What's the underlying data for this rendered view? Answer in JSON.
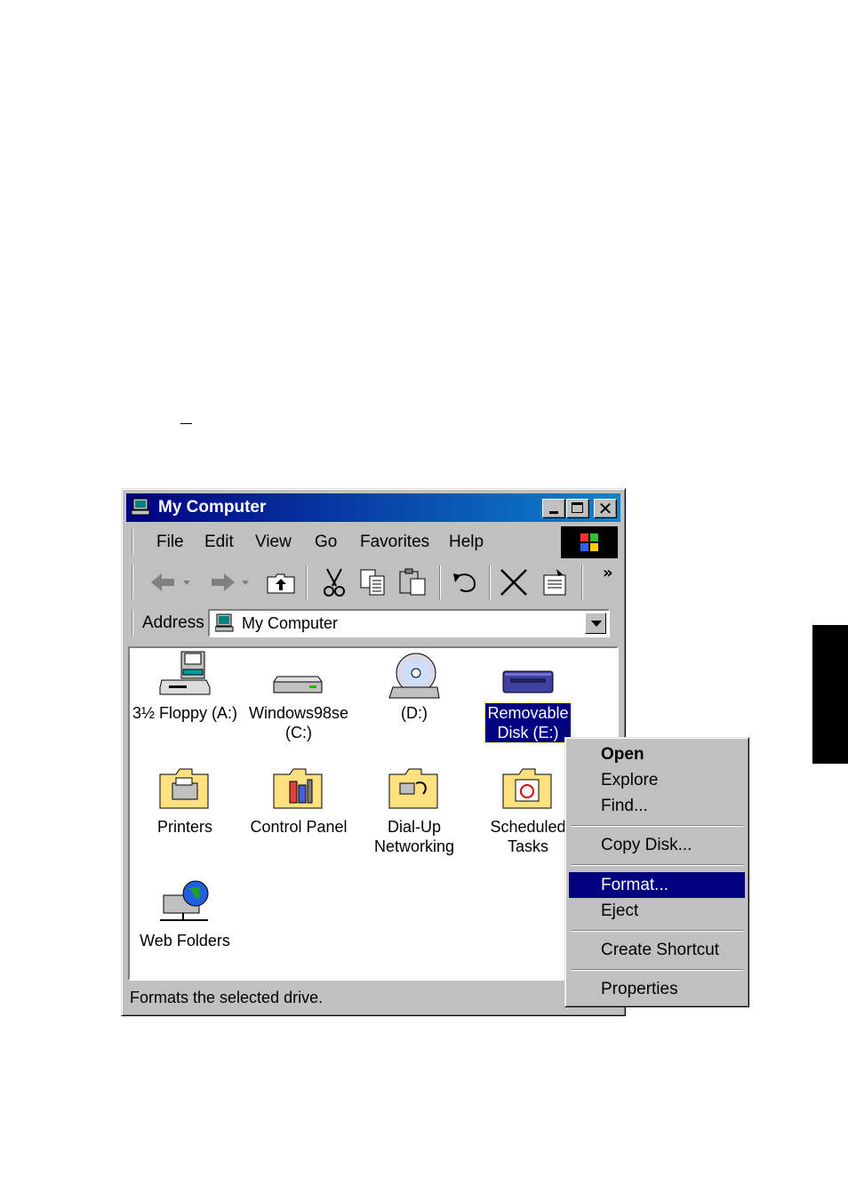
{
  "window": {
    "title": "My Computer",
    "menu": [
      "File",
      "Edit",
      "View",
      "Go",
      "Favorites",
      "Help"
    ],
    "toolbar_more": "»",
    "address": {
      "label": "Address",
      "value": "My Computer"
    },
    "close_glyph": "✕"
  },
  "items": [
    {
      "label": "3½ Floppy (A:)",
      "icon": "floppy-drive-icon"
    },
    {
      "label": "Windows98se (C:)",
      "icon": "hard-drive-icon"
    },
    {
      "label": "(D:)",
      "icon": "cd-drive-icon"
    },
    {
      "label": "Removable Disk (E:)",
      "icon": "removable-disk-icon",
      "selected": true
    },
    {
      "label": "Printers",
      "icon": "printers-folder-icon"
    },
    {
      "label": "Control Panel",
      "icon": "control-panel-folder-icon"
    },
    {
      "label": "Dial-Up Networking",
      "icon": "dialup-folder-icon"
    },
    {
      "label": "Scheduled Tasks",
      "icon": "scheduled-tasks-folder-icon"
    },
    {
      "label": "Web Folders",
      "icon": "web-folders-icon"
    }
  ],
  "status": "Formats the selected drive.",
  "context_menu": [
    {
      "label": "Open",
      "bold": true
    },
    {
      "label": "Explore"
    },
    {
      "label": "Find..."
    },
    {
      "label": "Copy Disk..."
    },
    {
      "label": "Format...",
      "highlighted": true
    },
    {
      "label": "Eject"
    },
    {
      "label": "Create Shortcut"
    },
    {
      "label": "Properties"
    }
  ],
  "colors": {
    "titlebar_start": "#000080",
    "titlebar_end": "#1084d0",
    "highlight": "#000080",
    "face": "#c0c0c0"
  }
}
